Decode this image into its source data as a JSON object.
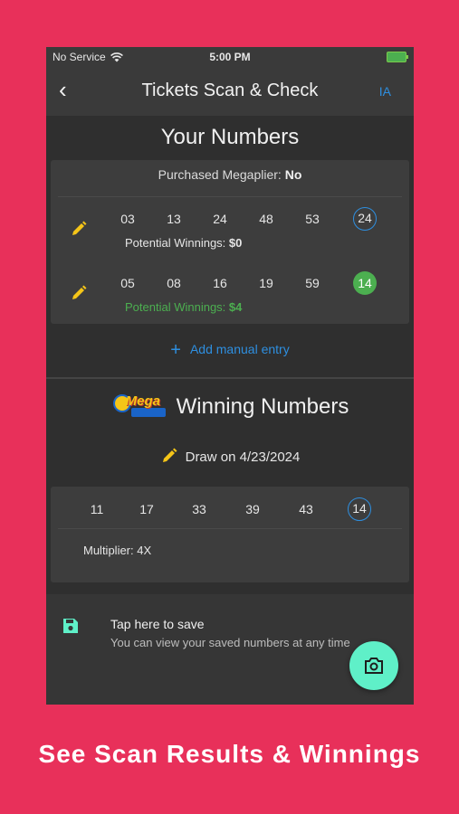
{
  "status": {
    "carrier": "No Service",
    "time": "5:00 PM"
  },
  "nav": {
    "title": "Tickets Scan & Check",
    "action": "IA"
  },
  "your_numbers": {
    "title": "Your Numbers",
    "megaplier_label": "Purchased Megaplier:",
    "megaplier_value": "No",
    "tickets": [
      {
        "numbers": [
          "03",
          "13",
          "24",
          "48",
          "53"
        ],
        "mega": "24",
        "winnings_label": "Potential Winnings:",
        "winnings": "$0",
        "win": false
      },
      {
        "numbers": [
          "05",
          "08",
          "16",
          "19",
          "59"
        ],
        "mega": "14",
        "winnings_label": "Potential Winnings:",
        "winnings": "$4",
        "win": true
      }
    ],
    "add_entry": "Add manual entry"
  },
  "winning": {
    "logo_text": "Mega",
    "title": "Winning Numbers",
    "draw": "Draw on 4/23/2024",
    "numbers": [
      "11",
      "17",
      "33",
      "39",
      "43"
    ],
    "mega": "14",
    "multiplier": "Multiplier: 4X"
  },
  "save": {
    "title": "Tap here to save",
    "subtitle": "You can view your saved numbers at any time"
  },
  "caption": "See Scan Results & Winnings",
  "colors": {
    "accent": "#2e8fe0",
    "win": "#4caf50",
    "fab": "#5ff0c8",
    "background": "#e8305a",
    "pencil": "#f5c518"
  }
}
